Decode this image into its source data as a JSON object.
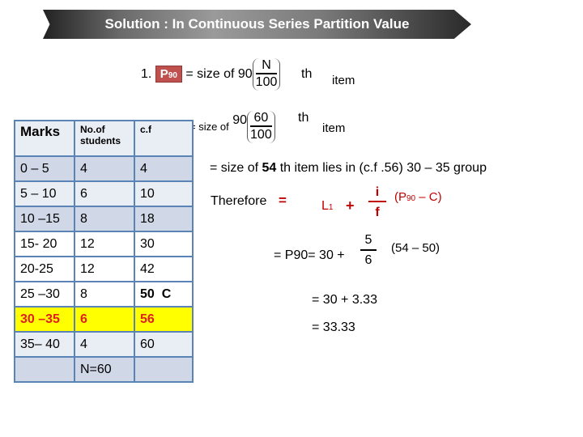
{
  "banner": {
    "title": "Solution : In Continuous Series  Partition Value"
  },
  "step1": {
    "number": "1.",
    "p90_label": "P",
    "p90_sub": "90",
    "equals_text": "= size of 90",
    "numerator": "N",
    "denominator": "100",
    "suffix_th": "th",
    "suffix_item": "item"
  },
  "step2": {
    "equals_text": "= size of",
    "coef": "90",
    "numerator": "60",
    "denominator": "100",
    "suffix_th": "th",
    "suffix_item": "item"
  },
  "step3": {
    "prefix": "= size of",
    "bold_value": "54",
    "rest": "th item  lies in (c.f .56) 30 – 35 group"
  },
  "formula": {
    "therefore": "Therefore",
    "equals": "=",
    "L": "L",
    "L_sub": "1",
    "plus": "+",
    "numerator": "i",
    "denominator": "f",
    "paren_open": "(P",
    "paren_sub": "90",
    "paren_rest": " – C)"
  },
  "substitution": {
    "prefix": "= P90= 30  +",
    "numerator": "5",
    "denominator": "6",
    "paren": "(54 – 50)"
  },
  "result1": "= 30 + 3.33",
  "result2": "= 33.33",
  "table": {
    "headers": [
      "Marks",
      "No.of students",
      "c.f"
    ],
    "rows": [
      {
        "marks": "0 – 5",
        "students": "4",
        "cf": "4"
      },
      {
        "marks": "5 – 10",
        "students": "6",
        "cf": "10"
      },
      {
        "marks": "10 –15",
        "students": "8",
        "cf": "18"
      },
      {
        "marks": "15- 20",
        "students": "12",
        "cf": "30"
      },
      {
        "marks": "20-25",
        "students": "12",
        "cf": "42"
      },
      {
        "marks": "25 –30",
        "students": "8",
        "cf": "50  C"
      },
      {
        "marks": "30 –35",
        "students": "6",
        "cf": "56"
      },
      {
        "marks": "35– 40",
        "students": "4",
        "cf": "60"
      },
      {
        "marks": "",
        "students": "N=60",
        "cf": ""
      }
    ]
  },
  "colors": {
    "highlight_row": "#ffff00",
    "highlight_text": "#e02020",
    "formula_red": "#c00000",
    "p90_box": "#c0504d",
    "table_border": "#5b84b6"
  }
}
